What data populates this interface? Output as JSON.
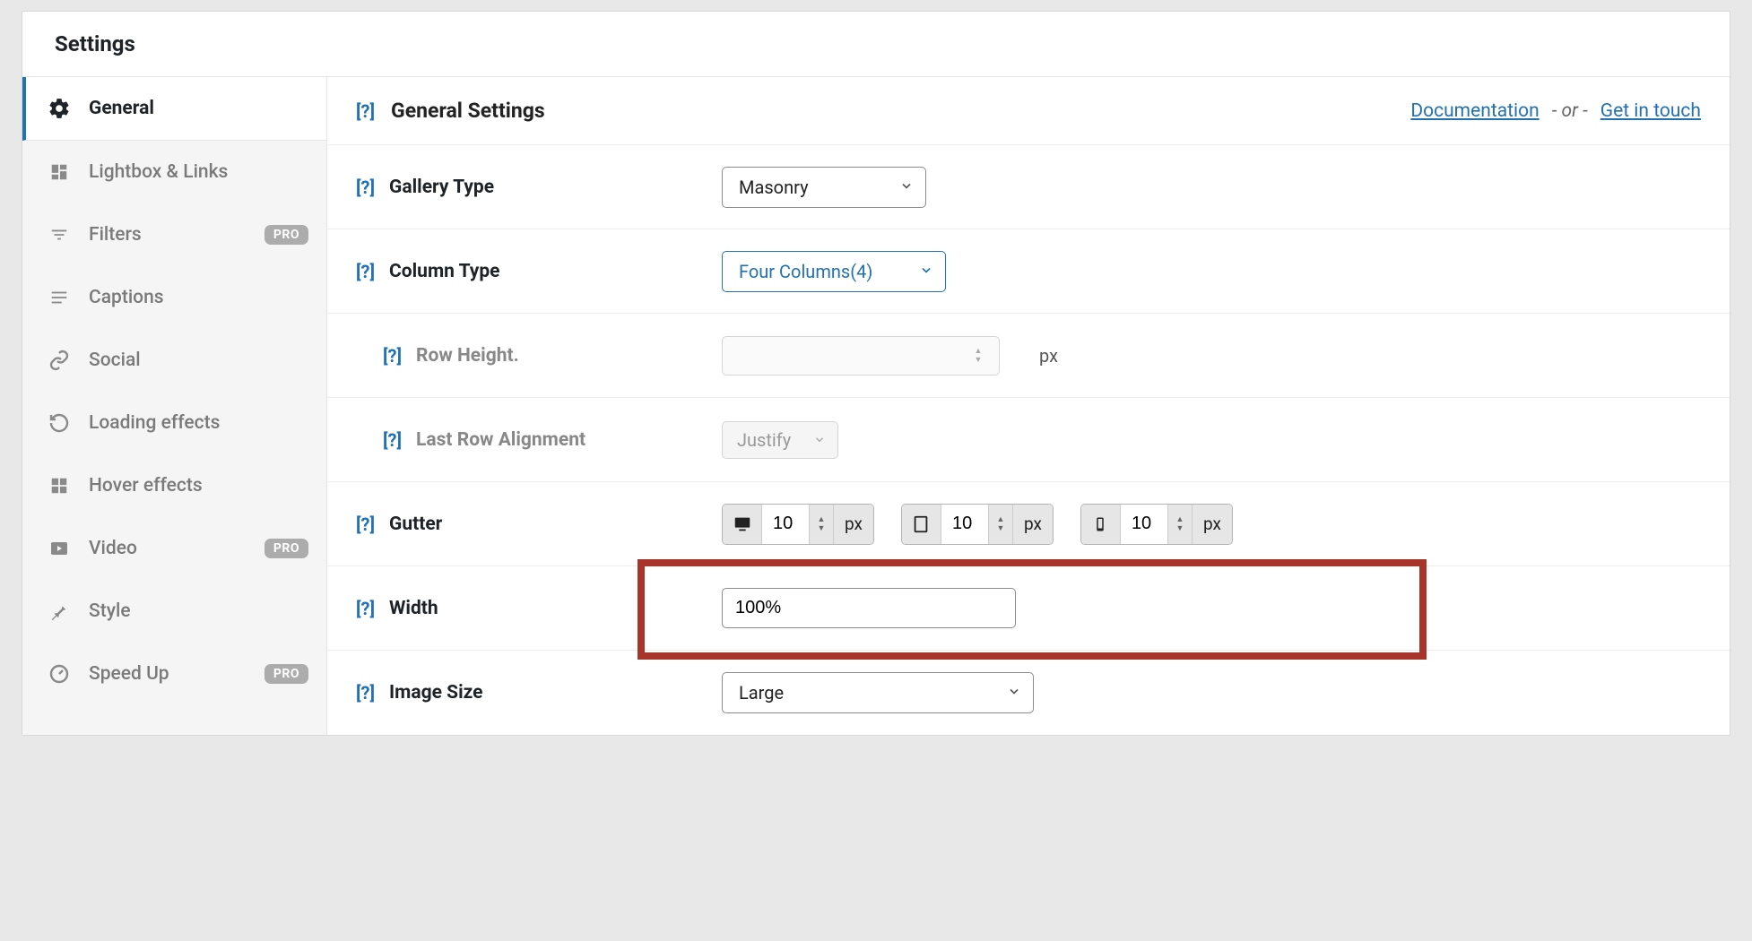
{
  "header": {
    "title": "Settings"
  },
  "sidebar": {
    "items": [
      {
        "label": "General",
        "active": true
      },
      {
        "label": "Lightbox & Links"
      },
      {
        "label": "Filters",
        "pro": true
      },
      {
        "label": "Captions"
      },
      {
        "label": "Social"
      },
      {
        "label": "Loading effects"
      },
      {
        "label": "Hover effects"
      },
      {
        "label": "Video",
        "pro": true
      },
      {
        "label": "Style"
      },
      {
        "label": "Speed Up",
        "pro": true
      }
    ],
    "pro_label": "PRO"
  },
  "topbar": {
    "title": "General Settings",
    "documentation": "Documentation",
    "or": "- or -",
    "contact": "Get in touch"
  },
  "rows": {
    "gallery_type": {
      "label": "Gallery Type",
      "value": "Masonry"
    },
    "column_type": {
      "label": "Column Type",
      "value": "Four Columns(4)"
    },
    "row_height": {
      "label": "Row Height.",
      "value": "",
      "unit": "px"
    },
    "last_row": {
      "label": "Last Row Alignment",
      "value": "Justify"
    },
    "gutter": {
      "label": "Gutter",
      "desktop": "10",
      "tablet": "10",
      "mobile": "10",
      "unit": "px"
    },
    "width": {
      "label": "Width",
      "value": "100%"
    },
    "image_size": {
      "label": "Image Size",
      "value": "Large"
    }
  },
  "help_marker": "[?]"
}
